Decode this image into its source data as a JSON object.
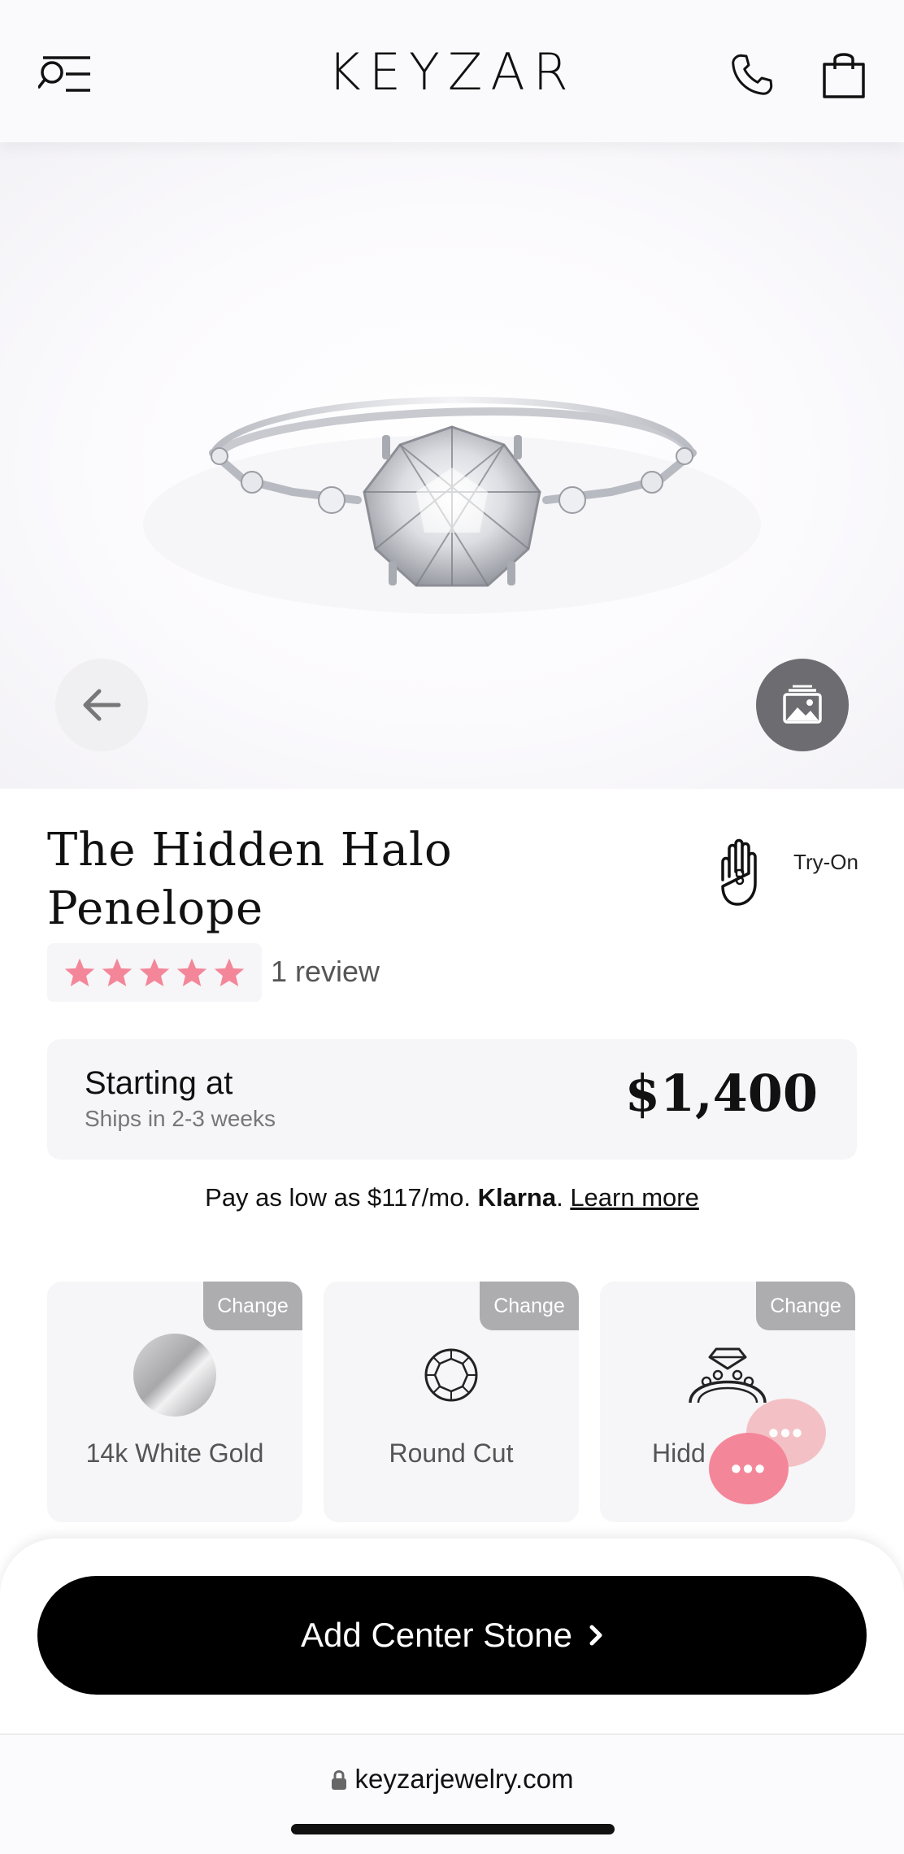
{
  "header": {
    "logo": "KEYZAR",
    "menu_icon": "search-menu-icon",
    "phone_icon": "phone-icon",
    "bag_icon": "shopping-bag-icon"
  },
  "hero": {
    "image": "diamond-ring-photo",
    "back_icon": "arrow-left-icon",
    "gallery_icon": "image-gallery-icon"
  },
  "product": {
    "title": "The Hidden Halo Penelope",
    "try_on_label": "Try-On",
    "rating": 5,
    "rating_max": 5,
    "review_text": "1 review",
    "star_color": "#f4869a"
  },
  "price": {
    "label": "Starting at",
    "shipping": "Ships in 2-3 weeks",
    "value": "$1,400"
  },
  "financing": {
    "text": "Pay as low as $117/mo.",
    "provider": "Klarna",
    "link": "Learn more"
  },
  "options": [
    {
      "change": "Change",
      "label": "14k White Gold",
      "icon": "white-gold-swatch-icon"
    },
    {
      "change": "Change",
      "label": "Round Cut",
      "icon": "round-diamond-icon"
    },
    {
      "change": "Change",
      "label": "Hidd",
      "icon": "ring-setting-icon"
    }
  ],
  "cta": {
    "label": "Add Center Stone"
  },
  "browser": {
    "url": "keyzarjewelry.com"
  }
}
